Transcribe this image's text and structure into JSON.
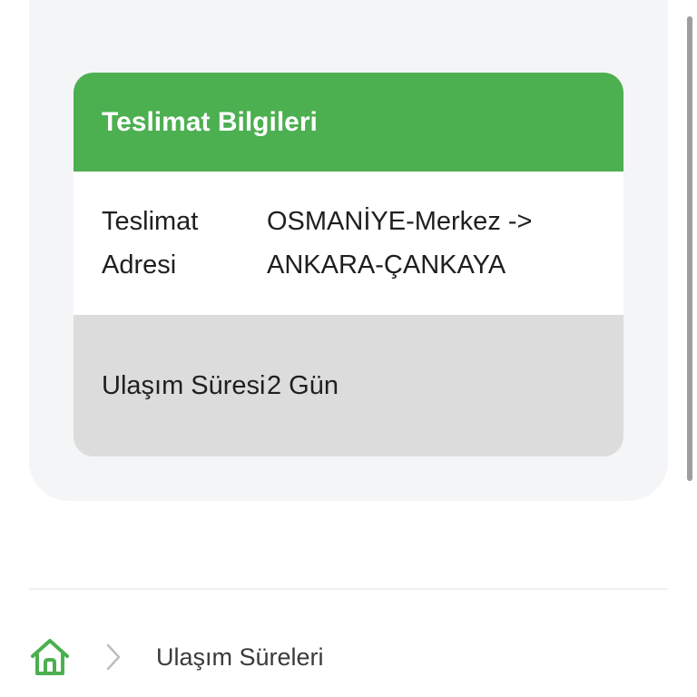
{
  "card": {
    "title": "Teslimat Bilgileri",
    "rows": [
      {
        "label": "Teslimat Adresi",
        "value": "OSMANİYE-Merkez -> ANKARA-ÇANKAYA"
      },
      {
        "label": "Ulaşım Süresi",
        "value": "2 Gün"
      }
    ]
  },
  "breadcrumb": {
    "home_icon": "home-icon",
    "separator_icon": "chevron-right-icon",
    "current": "Ulaşım Süreleri"
  },
  "colors": {
    "header_green": "#4caf50",
    "row_alt_gray": "#dcdcdc",
    "panel_bg": "#f4f5f7"
  }
}
